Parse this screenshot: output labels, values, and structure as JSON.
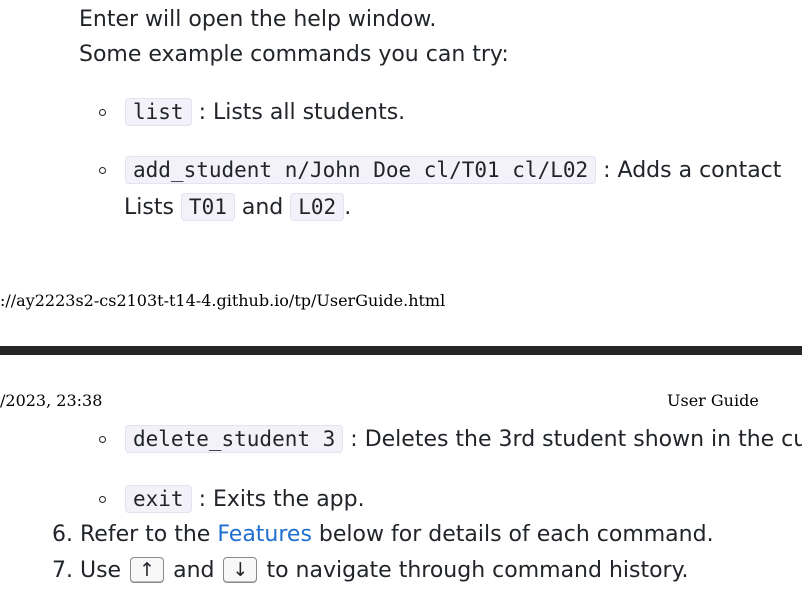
{
  "page_top": {
    "intro_line1": "Enter will open the help window.",
    "intro_line2": "Some example commands you can try:",
    "examples": [
      {
        "command": "list",
        "description": " : Lists all students."
      },
      {
        "command": "add_student n/John Doe cl/T01 cl/L02",
        "description": " : Adds a contact",
        "continuation_prefix": "Lists ",
        "class1": "T01",
        "joiner": " and ",
        "class2": "L02",
        "end": "."
      }
    ],
    "footer_url": "://ay2223s2-cs2103t-t14-4.github.io/tp/UserGuide.html"
  },
  "page_bottom": {
    "header_datetime": "/2023, 23:38",
    "header_title": "User Guide",
    "examples": [
      {
        "command": "delete_student 3",
        "description": " : Deletes the 3rd student shown in the cu"
      },
      {
        "command": "exit",
        "description": " : Exits the app."
      }
    ],
    "step6": {
      "number": "6.",
      "prefix": " Refer to the ",
      "link_text": "Features",
      "suffix": " below for details of each command."
    },
    "step7": {
      "number": "7.",
      "prefix": " Use ",
      "key_up": "↑",
      "middle": " and ",
      "key_down": "↓",
      "suffix": " to navigate through command history."
    }
  },
  "colors": {
    "link": "#1f6fd1",
    "code_background": "#f3f1fa",
    "divider": "#262626"
  }
}
